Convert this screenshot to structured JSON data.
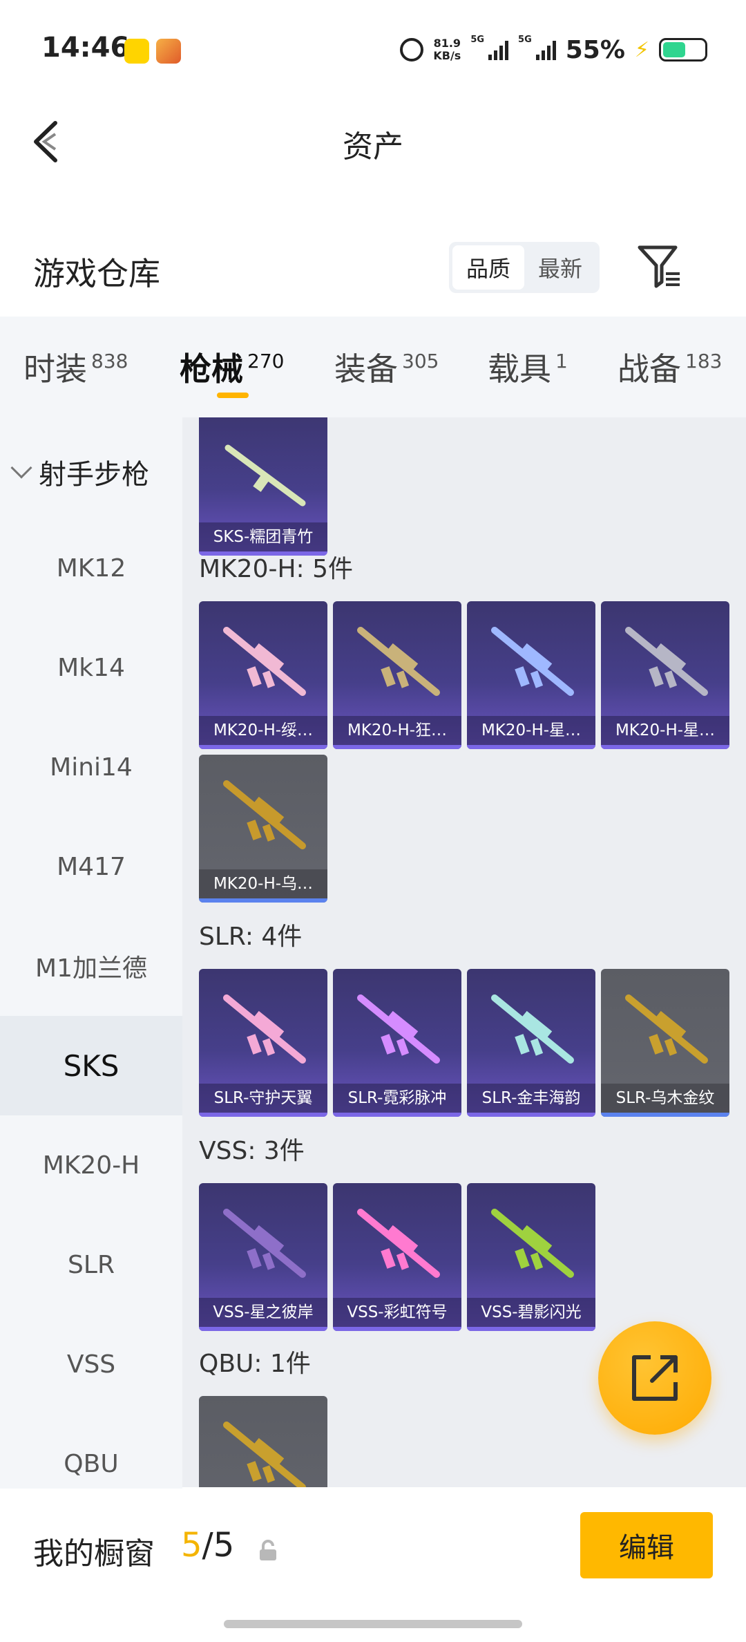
{
  "status_bar": {
    "time": "14:46",
    "net_speed_value": "81.9",
    "net_speed_unit": "KB/s",
    "sig1_label": "5G",
    "sig2_label": "5G",
    "battery": "55%"
  },
  "header": {
    "title": "资产"
  },
  "section": {
    "title": "游戏仓库",
    "sort_quality": "品质",
    "sort_latest": "最新"
  },
  "tabs": [
    {
      "label": "时装",
      "count": "838"
    },
    {
      "label": "枪械",
      "count": "270"
    },
    {
      "label": "装备",
      "count": "305"
    },
    {
      "label": "载具",
      "count": "1"
    },
    {
      "label": "战备",
      "count": "183"
    }
  ],
  "sidebar": {
    "group": "射手步枪",
    "items": [
      "MK12",
      "Mk14",
      "Mini14",
      "M417",
      "M1加兰德",
      "SKS",
      "MK20-H",
      "SLR",
      "VSS",
      "QBU"
    ],
    "active": "SKS"
  },
  "content": {
    "top_card": {
      "label": "SKS-糯团青竹"
    },
    "groups": [
      {
        "title": "MK20-H: 5件",
        "items": [
          {
            "label": "MK20-H-绥…",
            "color": "#f1b9d4"
          },
          {
            "label": "MK20-H-狂…",
            "color": "#c9b27a"
          },
          {
            "label": "MK20-H-星…",
            "color": "#9fb8ff"
          },
          {
            "label": "MK20-H-星…",
            "color": "#b6b6c6"
          },
          {
            "label": "MK20-H-乌…",
            "color": "#c79a2c"
          }
        ]
      },
      {
        "title": "SLR: 4件",
        "items": [
          {
            "label": "SLR-守护天翼",
            "color": "#f4a9d6"
          },
          {
            "label": "SLR-霓彩脉冲",
            "color": "#d58cff"
          },
          {
            "label": "SLR-金丰海韵",
            "color": "#a9e6e2"
          },
          {
            "label": "SLR-乌木金纹",
            "color": "#c9a02e"
          }
        ]
      },
      {
        "title": "VSS: 3件",
        "items": [
          {
            "label": "VSS-星之彼岸",
            "color": "#8e6fc9"
          },
          {
            "label": "VSS-彩虹符号",
            "color": "#ff7ad0"
          },
          {
            "label": "VSS-碧影闪光",
            "color": "#9fd23f"
          }
        ]
      },
      {
        "title": "QBU: 1件",
        "items": [
          {
            "label": "",
            "color": "#c9a02e"
          }
        ]
      }
    ]
  },
  "bottom_bar": {
    "title": "我的橱窗",
    "count_current": "5",
    "count_total": "/5",
    "edit_label": "编辑"
  }
}
